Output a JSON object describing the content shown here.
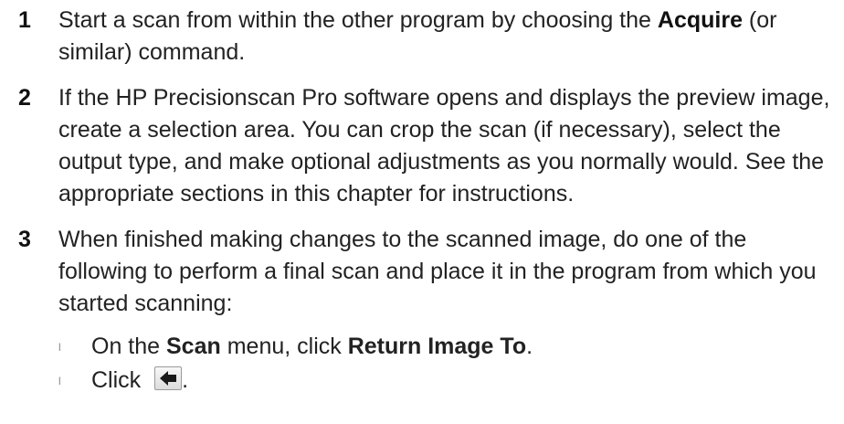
{
  "steps": [
    {
      "number": "1",
      "text_a": "Start a scan from within the other program by choosing the ",
      "bold_a": "Acquire",
      "text_b": " (or similar) command."
    },
    {
      "number": "2",
      "text": "If the HP Precisionscan Pro software opens and displays the preview image, create a selection area. You can crop the scan (if necessary), select the output type, and make optional adjustments as you normally would. See the appropriate sections in this chapter for instructions."
    },
    {
      "number": "3",
      "text": "When finished making changes to the scanned image, do one of the following to perform a final scan and place it in the program from which you started scanning:"
    }
  ],
  "sub_items": [
    {
      "bullet": "l",
      "text_a": "On the ",
      "bold_a": "Scan",
      "text_b": " menu, click ",
      "bold_b": "Return Image To",
      "text_c": "."
    },
    {
      "bullet": "l",
      "text_a": "Click ",
      "icon": "return-image-arrow-icon",
      "text_c": "."
    }
  ]
}
